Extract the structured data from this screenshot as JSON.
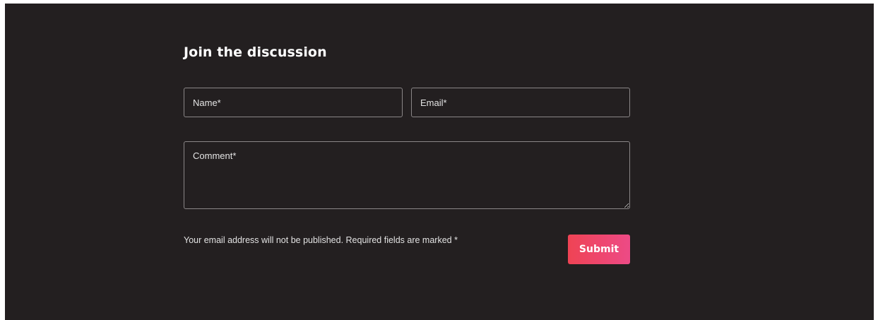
{
  "form": {
    "title": "Join the discussion",
    "name_placeholder": "Name*",
    "email_placeholder": "Email*",
    "comment_placeholder": "Comment*",
    "note": "Your email address will not be published. Required fields are marked *",
    "submit_label": "Submit"
  },
  "colors": {
    "background": "#231f20",
    "button_gradient_start": "#ef4354",
    "button_gradient_end": "#ed4a86"
  }
}
